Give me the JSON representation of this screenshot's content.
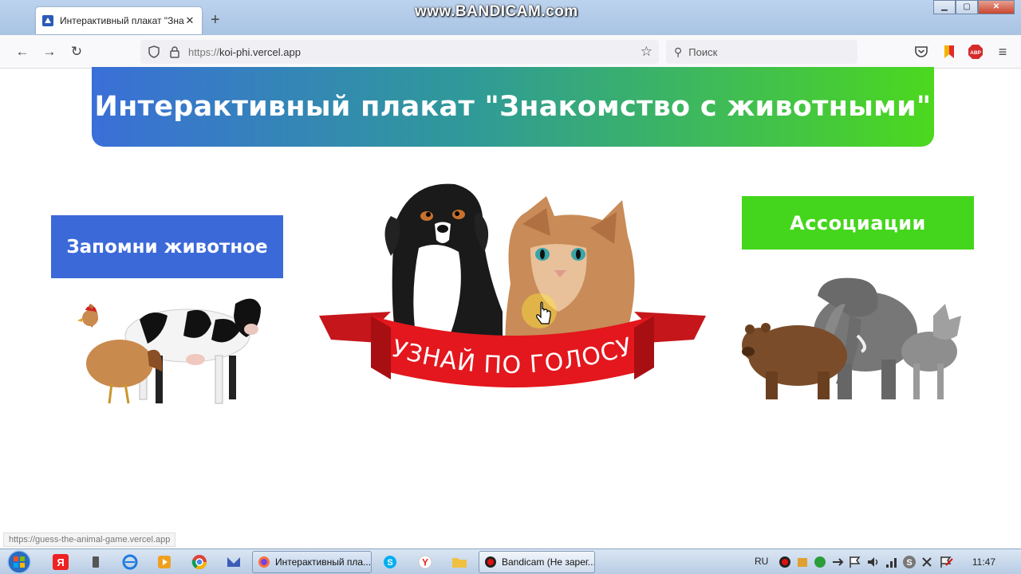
{
  "watermark": "www.BANDICAM.com",
  "browser": {
    "tab_title": "Интерактивный плакат \"Знакомство",
    "new_tab": "+",
    "tab_close": "✕",
    "url_scheme": "https://",
    "url_host": "koi-phi.vercel.app",
    "search_placeholder": "Поиск",
    "status_url": "https://guess-the-animal-game.vercel.app"
  },
  "page": {
    "title": "Интерактивный плакат \"Знакомство с животными\"",
    "left_button": "Запомни животное",
    "right_button": "Ассоциации",
    "ribbon_text": "УЗНАЙ ПО ГОЛОСУ",
    "colors": {
      "banner_start": "#3a6fd8",
      "banner_end": "#4cd81e",
      "left_button": "#3c69d8",
      "right_button": "#44d61c",
      "ribbon": "#e3171d"
    }
  },
  "taskbar": {
    "tasks": [
      {
        "label": "Интерактивный пла...",
        "icon": "firefox-icon"
      },
      {
        "label": "Bandicam (Не зарег...",
        "icon": "bandicam-icon"
      }
    ],
    "lang": "RU",
    "time": "11:47"
  }
}
